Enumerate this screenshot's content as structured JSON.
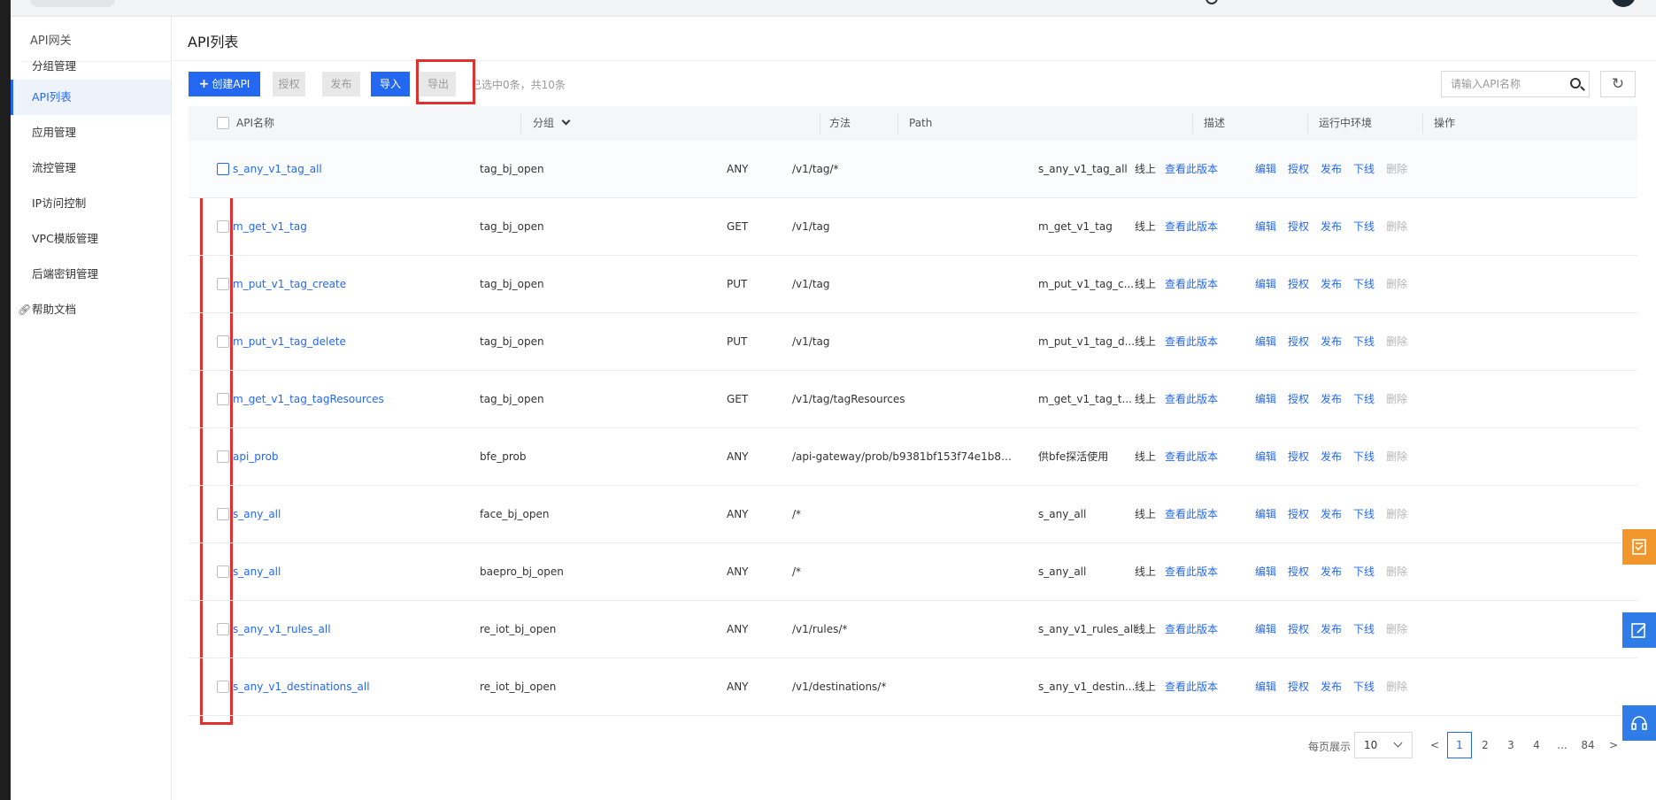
{
  "sidebar": {
    "title": "API网关",
    "items": [
      {
        "label": "分组管理",
        "active": false
      },
      {
        "label": "API列表",
        "active": true
      },
      {
        "label": "应用管理",
        "active": false
      },
      {
        "label": "流控管理",
        "active": false
      },
      {
        "label": "IP访问控制",
        "active": false
      },
      {
        "label": "VPC模版管理",
        "active": false
      },
      {
        "label": "后端密钥管理",
        "active": false
      },
      {
        "label": "帮助文档",
        "active": false,
        "icon": "link-icon"
      }
    ]
  },
  "page": {
    "title": "API列表"
  },
  "toolbar": {
    "create_label": "创建API",
    "authorize_label": "授权",
    "publish_label": "发布",
    "import_label": "导入",
    "export_label": "导出",
    "selected_info": "已选中0条，共10条",
    "search_placeholder": "请输入API名称"
  },
  "table": {
    "headers": {
      "name": "API名称",
      "group": "分组",
      "method": "方法",
      "path": "Path",
      "desc": "描述",
      "env": "运行中环境",
      "ops": "操作"
    },
    "rows": [
      {
        "name": "s_any_v1_tag_all",
        "group": "tag_bj_open",
        "method": "ANY",
        "path": "/v1/tag/*",
        "desc": "s_any_v1_tag_all",
        "env": "线上",
        "version_link": "查看此版本"
      },
      {
        "name": "m_get_v1_tag",
        "group": "tag_bj_open",
        "method": "GET",
        "path": "/v1/tag",
        "desc": "m_get_v1_tag",
        "env": "线上",
        "version_link": "查看此版本"
      },
      {
        "name": "m_put_v1_tag_create",
        "group": "tag_bj_open",
        "method": "PUT",
        "path": "/v1/tag",
        "desc": "m_put_v1_tag_c...",
        "env": "线上",
        "version_link": "查看此版本"
      },
      {
        "name": "m_put_v1_tag_delete",
        "group": "tag_bj_open",
        "method": "PUT",
        "path": "/v1/tag",
        "desc": "m_put_v1_tag_d...",
        "env": "线上",
        "version_link": "查看此版本"
      },
      {
        "name": "m_get_v1_tag_tagResources",
        "group": "tag_bj_open",
        "method": "GET",
        "path": "/v1/tag/tagResources",
        "desc": "m_get_v1_tag_t...",
        "env": "线上",
        "version_link": "查看此版本"
      },
      {
        "name": "api_prob",
        "group": "bfe_prob",
        "method": "ANY",
        "path": "/api-gateway/prob/b9381bf153f74e1b84...",
        "desc": "供bfe探活使用",
        "env": "线上",
        "version_link": "查看此版本"
      },
      {
        "name": "s_any_all",
        "group": "face_bj_open",
        "method": "ANY",
        "path": "/*",
        "desc": "s_any_all",
        "env": "线上",
        "version_link": "查看此版本"
      },
      {
        "name": "s_any_all",
        "group": "baepro_bj_open",
        "method": "ANY",
        "path": "/*",
        "desc": "s_any_all",
        "env": "线上",
        "version_link": "查看此版本"
      },
      {
        "name": "s_any_v1_rules_all",
        "group": "re_iot_bj_open",
        "method": "ANY",
        "path": "/v1/rules/*",
        "desc": "s_any_v1_rules_all",
        "env": "线上",
        "version_link": "查看此版本"
      },
      {
        "name": "s_any_v1_destinations_all",
        "group": "re_iot_bj_open",
        "method": "ANY",
        "path": "/v1/destinations/*",
        "desc": "s_any_v1_destin...",
        "env": "线上",
        "version_link": "查看此版本"
      }
    ],
    "ops": {
      "edit": "编辑",
      "authorize": "授权",
      "publish": "发布",
      "offline": "下线",
      "delete": "删除"
    }
  },
  "pagination": {
    "per_page_label": "每页展示",
    "per_page_value": "10",
    "prev": "<",
    "next": ">",
    "pages": [
      "1",
      "2",
      "3",
      "4",
      "...",
      "84"
    ],
    "current": "1"
  },
  "floating_icons": [
    "checklist-icon",
    "edit-note-icon",
    "headset-icon"
  ],
  "colors": {
    "accent": "#2468f2",
    "highlight": "#e03131",
    "float_orange": "#f0962b",
    "float_blue": "#2f7ce8"
  }
}
